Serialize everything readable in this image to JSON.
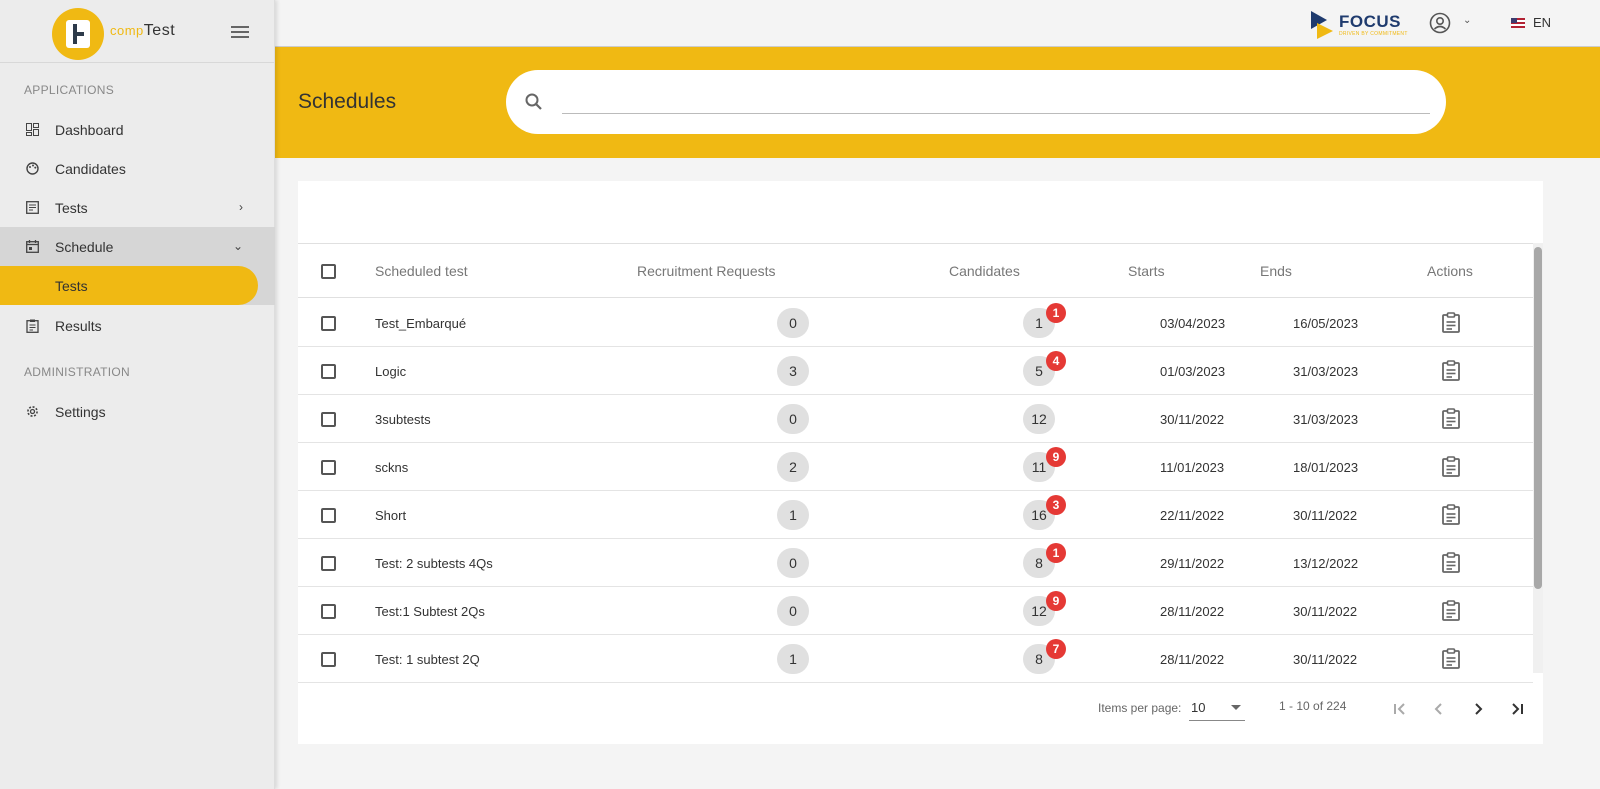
{
  "app": {
    "brand_prefix": "comp",
    "brand_suffix": "Test",
    "accent_color": "#f0b913"
  },
  "sidebar": {
    "sections": [
      {
        "label": "APPLICATIONS"
      },
      {
        "label": "ADMINISTRATION"
      }
    ],
    "items": {
      "dashboard": {
        "label": "Dashboard",
        "icon": "dashboard-icon"
      },
      "candidates": {
        "label": "Candidates",
        "icon": "palette-icon"
      },
      "tests": {
        "label": "Tests",
        "icon": "test-icon"
      },
      "schedule": {
        "label": "Schedule",
        "icon": "calendar-icon"
      },
      "schedule_tests": {
        "label": "Tests"
      },
      "results": {
        "label": "Results",
        "icon": "clipboard-icon"
      },
      "settings": {
        "label": "Settings",
        "icon": "gear-icon"
      }
    }
  },
  "topbar": {
    "partner_name": "FOCUS",
    "partner_tagline": "DRIVEN BY COMMITMENT",
    "language": "EN"
  },
  "header": {
    "title": "Schedules",
    "search_placeholder": ""
  },
  "table": {
    "columns": {
      "scheduled_test": "Scheduled test",
      "recruitment_requests": "Recruitment Requests",
      "candidates": "Candidates",
      "starts": "Starts",
      "ends": "Ends",
      "actions": "Actions"
    },
    "rows": [
      {
        "name": "Test_Embarqué",
        "requests": "0",
        "candidates": "1",
        "badge": "1",
        "starts": "03/04/2023",
        "ends": "16/05/2023"
      },
      {
        "name": "Logic",
        "requests": "3",
        "candidates": "5",
        "badge": "4",
        "starts": "01/03/2023",
        "ends": "31/03/2023"
      },
      {
        "name": "3subtests",
        "requests": "0",
        "candidates": "12",
        "badge": "",
        "starts": "30/11/2022",
        "ends": "31/03/2023"
      },
      {
        "name": "sckns",
        "requests": "2",
        "candidates": "11",
        "badge": "9",
        "starts": "11/01/2023",
        "ends": "18/01/2023"
      },
      {
        "name": "Short",
        "requests": "1",
        "candidates": "16",
        "badge": "3",
        "starts": "22/11/2022",
        "ends": "30/11/2022"
      },
      {
        "name": "Test: 2 subtests 4Qs",
        "requests": "0",
        "candidates": "8",
        "badge": "1",
        "starts": "29/11/2022",
        "ends": "13/12/2022"
      },
      {
        "name": "Test:1 Subtest 2Qs",
        "requests": "0",
        "candidates": "12",
        "badge": "9",
        "starts": "28/11/2022",
        "ends": "30/11/2022"
      },
      {
        "name": "Test: 1 subtest 2Q",
        "requests": "1",
        "candidates": "8",
        "badge": "7",
        "starts": "28/11/2022",
        "ends": "30/11/2022"
      }
    ]
  },
  "paginator": {
    "items_per_page_label": "Items per page:",
    "items_per_page": "10",
    "range": "1 - 10 of 224"
  }
}
